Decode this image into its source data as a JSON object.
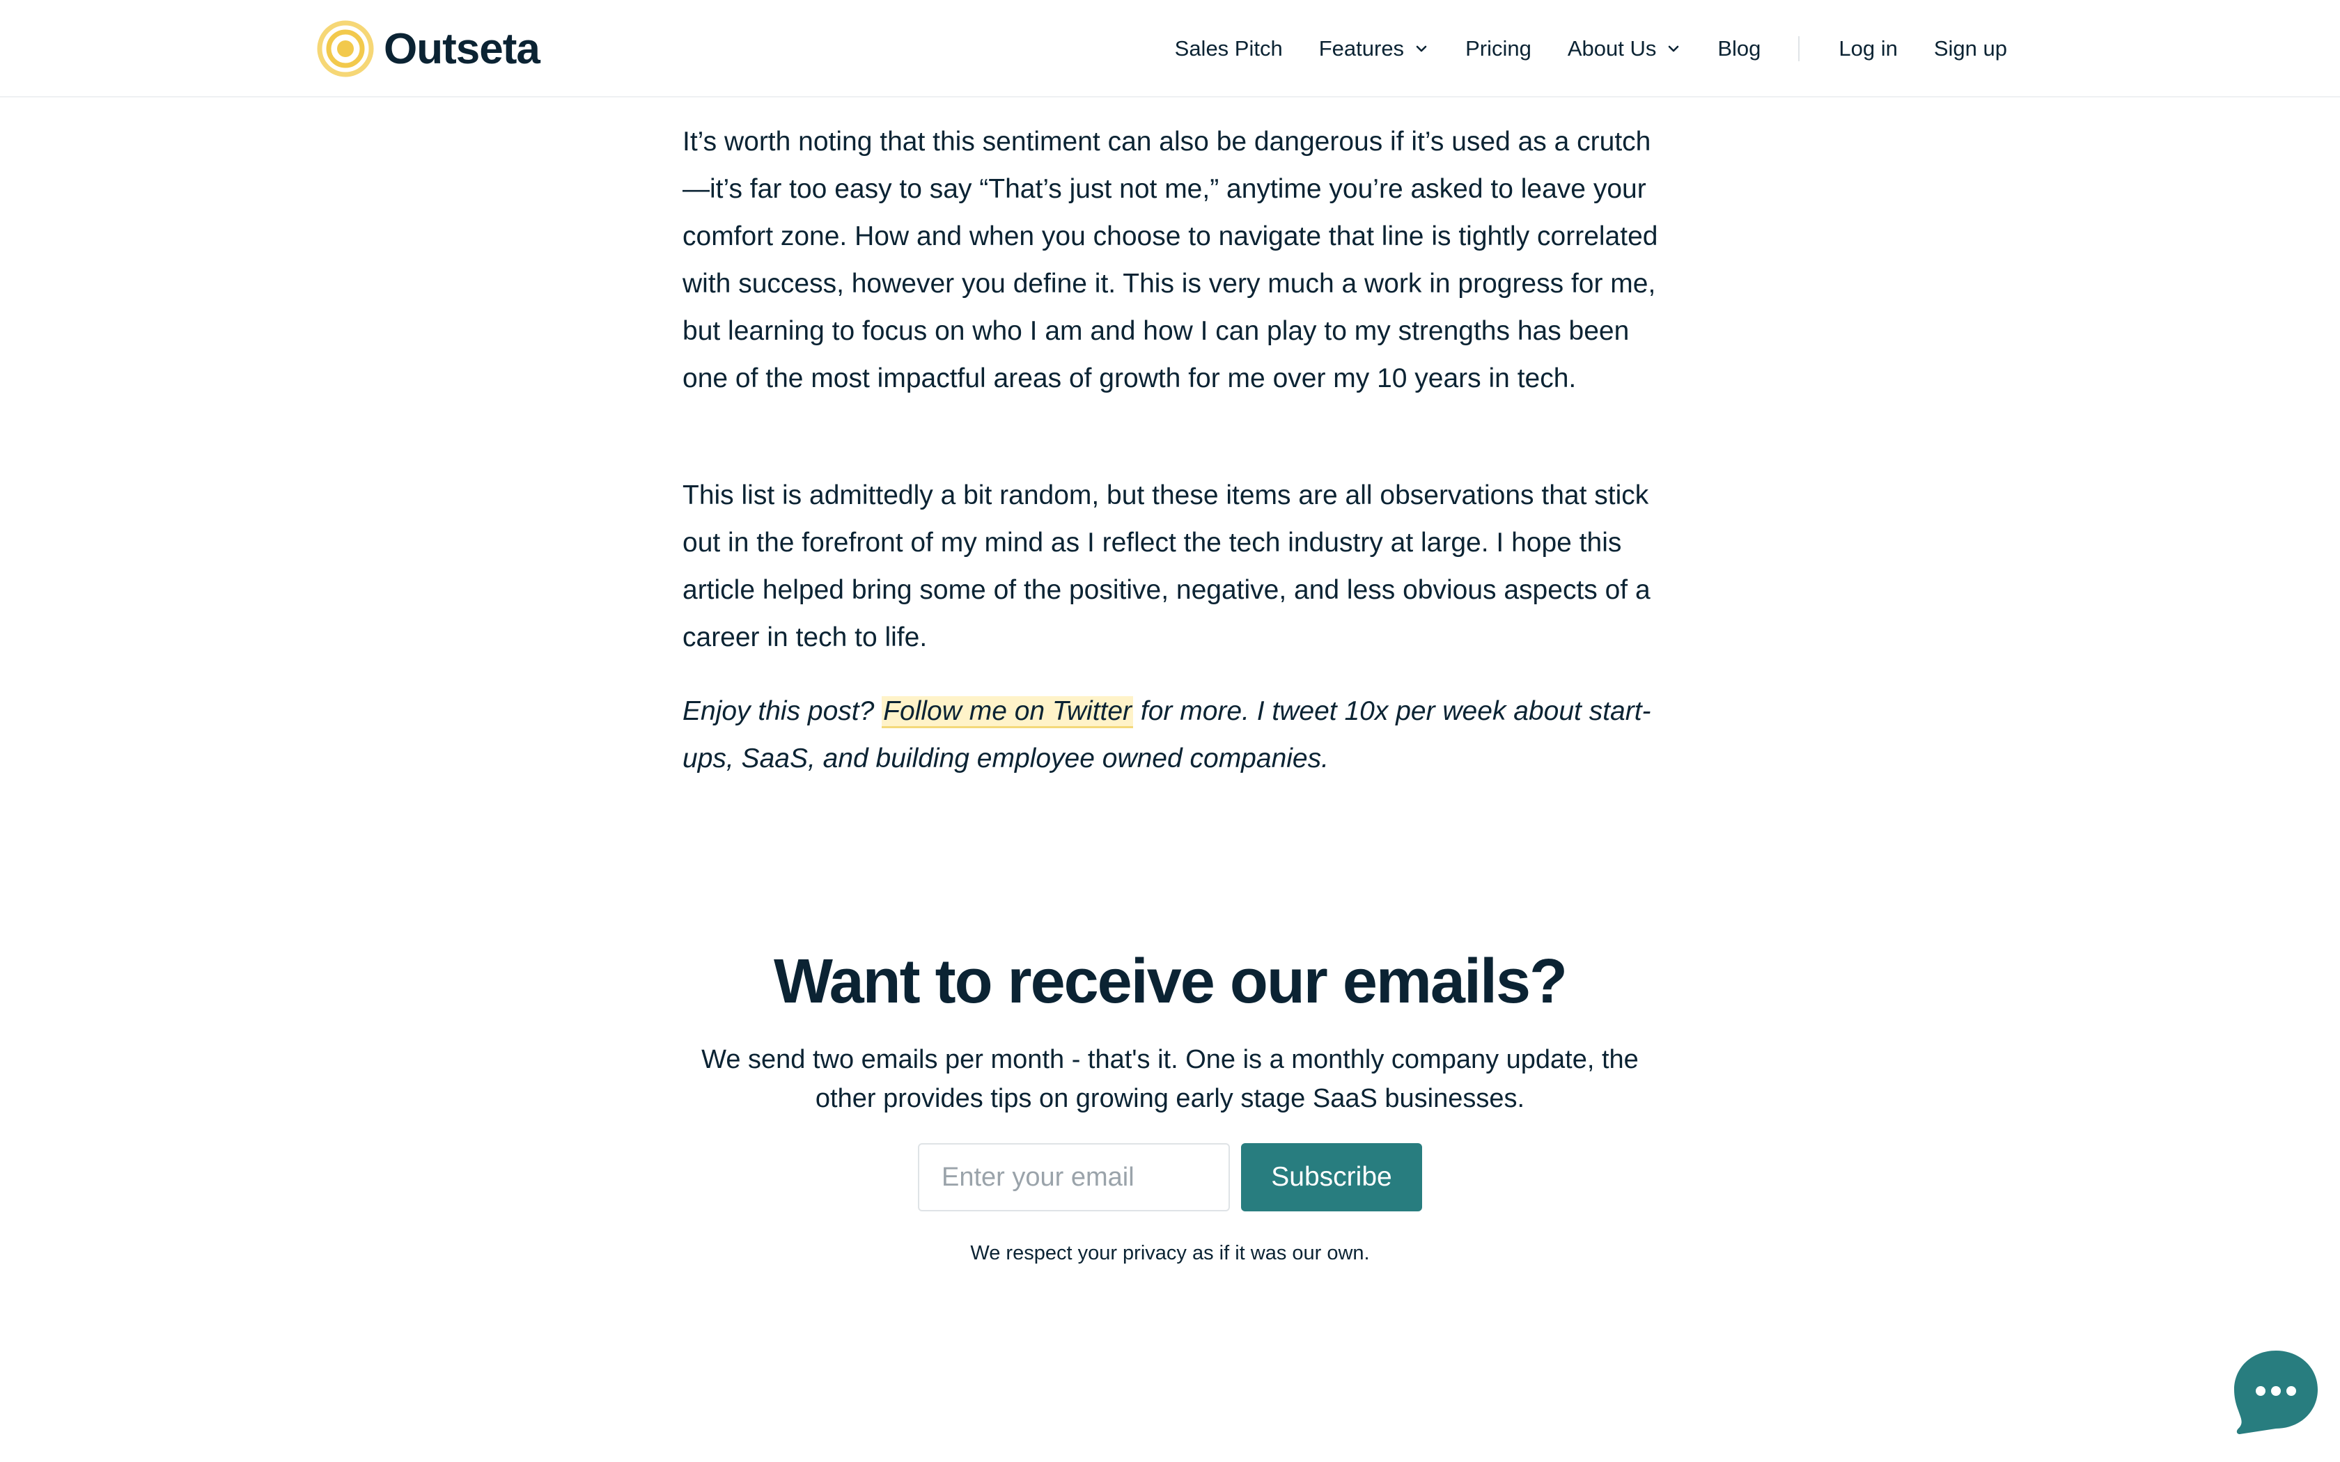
{
  "brand": {
    "name": "Outseta",
    "logo_icon": "concentric-circles-icon",
    "logo_colors": [
      "#f6d776",
      "#f2c94c"
    ]
  },
  "nav": {
    "items": [
      {
        "label": "Sales Pitch"
      },
      {
        "label": "Features",
        "icon": "chevron-down-icon"
      },
      {
        "label": "Pricing"
      },
      {
        "label": "About Us",
        "icon": "chevron-down-icon"
      },
      {
        "label": "Blog"
      }
    ],
    "login_label": "Log in",
    "signup_label": "Sign up"
  },
  "article": {
    "paragraph_1": "It’s worth noting that this sentiment can also be dangerous if it’s used as a crutch—it’s far too easy to say “That’s just not me,” anytime you’re asked to leave your comfort zone. How and when you choose to navigate that line is tightly correlated with success, however you define it. This is very much a work in progress for me, but learning to focus on who I am and how I can play to my strengths has been one of the most impactful areas of growth for me over my 10 years in tech.",
    "paragraph_2": "This list is admittedly a bit random, but these items are all observations that stick out in the forefront of my mind as I reflect the tech industry at large. I hope this article helped bring some of the positive, negative, and less obvious aspects of a career in tech to life.",
    "cta_prefix": "Enjoy this post? ",
    "cta_link": "Follow me on Twitter",
    "cta_suffix": " for more. I tweet 10x per week about start-ups, SaaS, and building employee owned companies."
  },
  "newsletter": {
    "title": "Want to receive our emails?",
    "description": "We send two emails per month - that's it. One is a monthly company update, the other provides tips on growing early stage SaaS businesses.",
    "email_placeholder": "Enter your email",
    "email_value": "",
    "subscribe_label": "Subscribe",
    "privacy_note": "We respect your privacy as if it was our own."
  },
  "chat": {
    "icon": "chat-bubble-icon"
  },
  "colors": {
    "text": "#0b2333",
    "accent": "#287d7f",
    "link_highlight": "#fff3c9",
    "link_underline": "#f4d97a",
    "chat_bubble": "#287d7f"
  }
}
